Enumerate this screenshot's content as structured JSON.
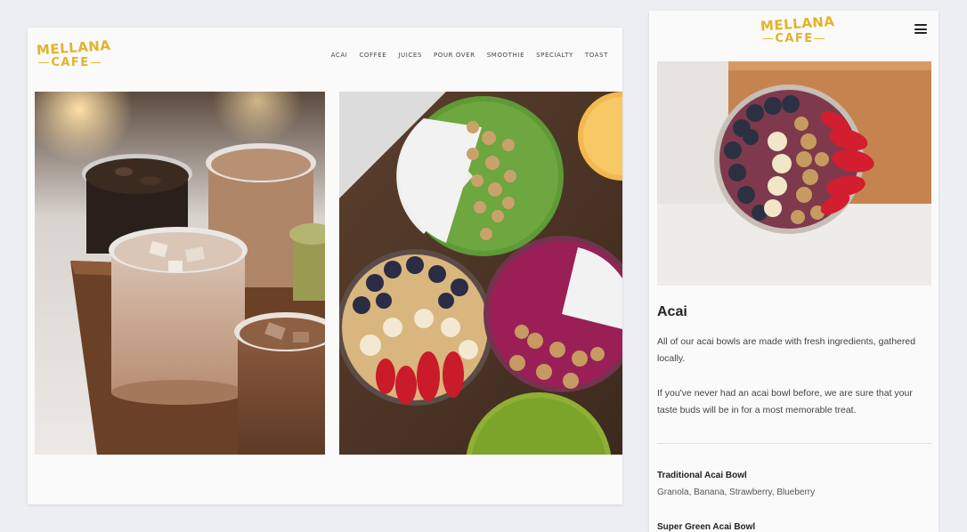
{
  "brand": {
    "line1": "MELLANA",
    "line2": "CAFE",
    "color": "#e1b428"
  },
  "nav": {
    "items": [
      "ACAI",
      "COFFEE",
      "JUICES",
      "POUR OVER",
      "SMOOTHIE",
      "SPECIALTY",
      "TOAST"
    ]
  },
  "mobile": {
    "menu_icon": "hamburger-icon",
    "section_title": "Acai",
    "para1": "All of our acai bowls are made with fresh ingredients, gathered locally.",
    "para2": "If you've never had an acai bowl before, we are sure that your taste buds will be in for a most memorable treat.",
    "items": [
      {
        "name": "Traditional Acai Bowl",
        "desc": "Granola, Banana, Strawberry, Blueberry"
      },
      {
        "name": "Super Green Acai Bowl",
        "desc": ""
      }
    ]
  }
}
